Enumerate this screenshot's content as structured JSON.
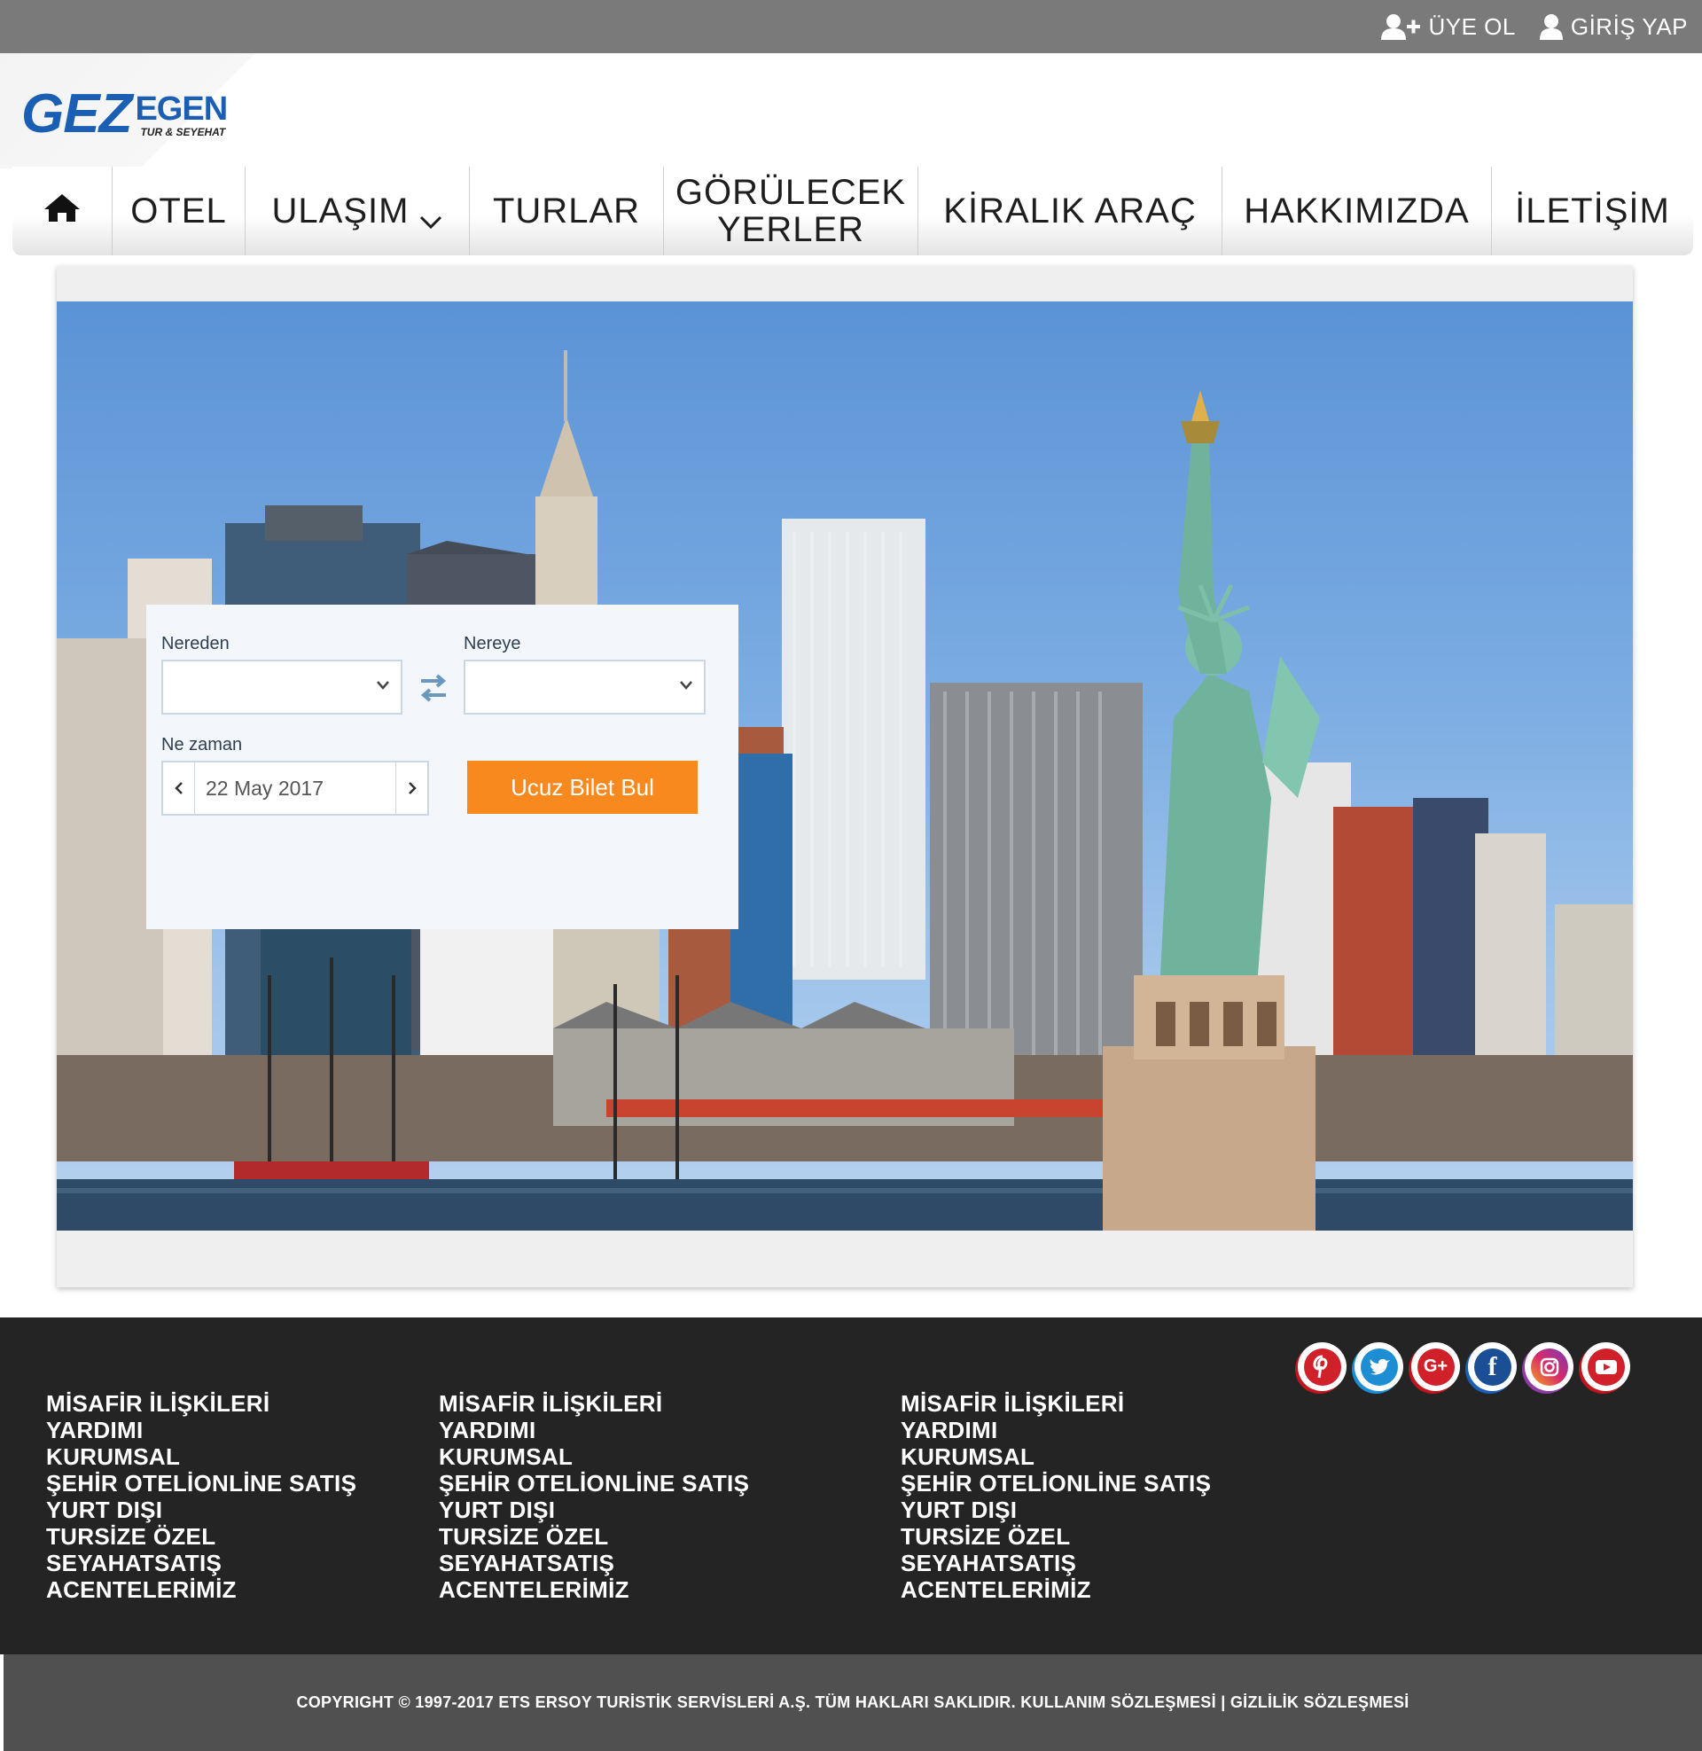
{
  "topbar": {
    "register": "ÜYE OL",
    "login": "GİRİŞ YAP"
  },
  "logo": {
    "main": "GEZ",
    "secondary": "EGEN",
    "tagline": "TUR & SEYEHAT"
  },
  "nav": {
    "home_icon": "home-icon",
    "items": [
      "OTEL",
      "ULAŞIM",
      "TURLAR",
      "GÖRÜLECEK YERLER",
      "KİRALIK ARAÇ",
      "HAKKIMIZDA",
      "İLETİŞİM"
    ]
  },
  "search": {
    "from_label": "Nereden",
    "from_value": "",
    "to_label": "Nereye",
    "to_value": "",
    "date_label": "Ne zaman",
    "date_value": "22 May 2017",
    "button": "Ucuz Bilet Bul"
  },
  "footer": {
    "columns": [
      [
        "MİSAFİR İLİŞKİLERİ",
        "YARDIMI",
        "KURUMSAL",
        "ŞEHİR OTELİONLİNE SATIŞ",
        "YURT DIŞI",
        "TURSİZE ÖZEL",
        "SEYAHATSATIŞ",
        "ACENTELERİMİZ"
      ],
      [
        "MİSAFİR İLİŞKİLERİ",
        "YARDIMI",
        "KURUMSAL",
        "ŞEHİR OTELİONLİNE SATIŞ",
        "YURT DIŞI",
        "TURSİZE ÖZEL",
        "SEYAHATSATIŞ",
        "ACENTELERİMİZ"
      ],
      [
        "MİSAFİR İLİŞKİLERİ",
        "YARDIMI",
        "KURUMSAL",
        "ŞEHİR OTELİONLİNE SATIŞ",
        "YURT DIŞI",
        "TURSİZE ÖZEL",
        "SEYAHATSATIŞ",
        "ACENTELERİMİZ"
      ]
    ],
    "socials": [
      "pinterest-icon",
      "twitter-icon",
      "google-plus-icon",
      "facebook-icon",
      "instagram-icon",
      "youtube-icon"
    ],
    "copyright": "COPYRIGHT © 1997-2017 ETS ERSOY TURİSTİK SERVİSLERİ A.Ş. TÜM HAKLARI SAKLIDIR. KULLANIM SÖZLEŞMESİ | GİZLİLİK SÖZLEŞMESİ"
  },
  "colors": {
    "topbar": "#7a7a7a",
    "brand_blue": "#1a5fb4",
    "button_orange": "#f7891f",
    "footer_bg": "#242424",
    "copyright_bg": "#505050"
  }
}
